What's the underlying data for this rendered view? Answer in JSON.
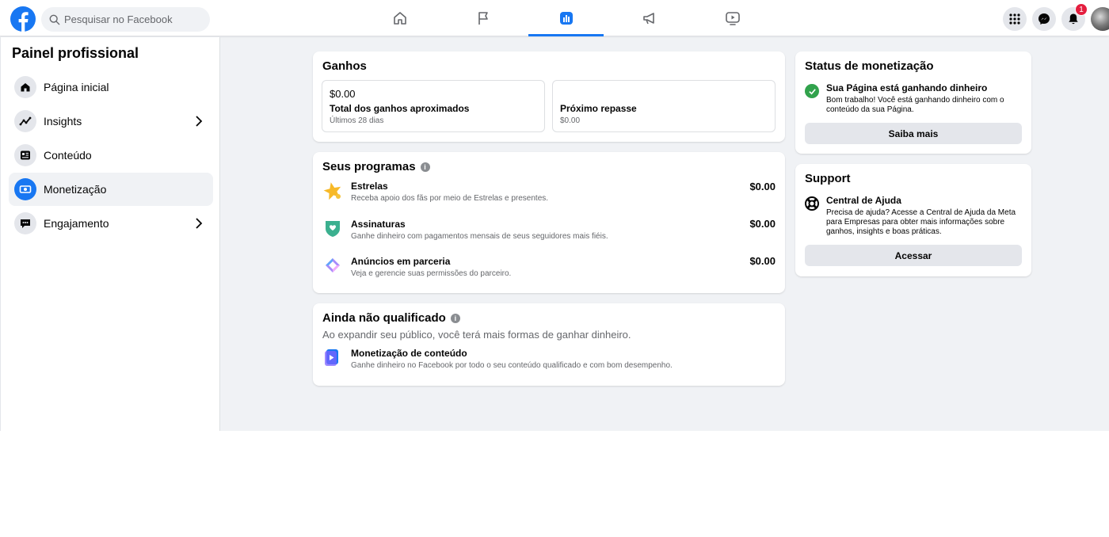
{
  "header": {
    "search_placeholder": "Pesquisar no Facebook",
    "notifications_count": "1",
    "brand_color": "#1877f2"
  },
  "nav_tabs": [
    {
      "icon": "home-icon",
      "active": false
    },
    {
      "icon": "flag-icon",
      "active": false
    },
    {
      "icon": "bar-chart-icon",
      "active": true
    },
    {
      "icon": "megaphone-icon",
      "active": false
    },
    {
      "icon": "video-icon",
      "active": false
    }
  ],
  "sidebar": {
    "title": "Painel profissional",
    "items": [
      {
        "label": "Página inicial",
        "icon": "home-icon"
      },
      {
        "label": "Insights",
        "icon": "trend-icon"
      },
      {
        "label": "Conteúdo",
        "icon": "content-icon"
      },
      {
        "label": "Monetização",
        "icon": "money-icon",
        "active": true
      },
      {
        "label": "Engajamento",
        "icon": "chat-icon"
      }
    ]
  },
  "ganhos": {
    "title": "Ganhos",
    "total_value": "$0.00",
    "total_label": "Total dos ganhos aproximados",
    "total_period": "Últimos 28 dias",
    "next_label": "Próximo repasse",
    "next_value": "$0.00"
  },
  "programas": {
    "title": "Seus programas",
    "items": [
      {
        "name": "Estrelas",
        "desc": "Receba apoio dos fãs por meio de Estrelas e presentes.",
        "amount": "$0.00",
        "icon": "star-icon"
      },
      {
        "name": "Assinaturas",
        "desc": "Ganhe dinheiro com pagamentos mensais de seus seguidores mais fiéis.",
        "amount": "$0.00",
        "icon": "subscription-shield-icon"
      },
      {
        "name": "Anúncios em parceria",
        "desc": "Veja e gerencie suas permissões do parceiro.",
        "amount": "$0.00",
        "icon": "partnership-icon"
      }
    ]
  },
  "qualificado": {
    "title": "Ainda não qualificado",
    "subtitle": "Ao expandir seu público, você terá mais formas de ganhar dinheiro.",
    "item_name": "Monetização de conteúdo",
    "item_desc": "Ganhe dinheiro no Facebook por todo o seu conteúdo qualificado e com bom desempenho."
  },
  "status": {
    "title": "Status de monetização",
    "headline": "Sua Página está ganhando dinheiro",
    "desc_line1": "Bom trabalho! Você está ganhando dinheiro com o",
    "desc_line2": "conteúdo da sua Página.",
    "button": "Saiba mais",
    "ok_color": "#31a24c"
  },
  "support": {
    "title": "Support",
    "headline": "Central de Ajuda",
    "desc_line1": "Precisa de ajuda? Acesse a Central de Ajuda da Meta",
    "desc_line2": "para Empresas para obter mais informações sobre",
    "desc_line3": "ganhos, insights e boas práticas.",
    "button": "Acessar"
  }
}
